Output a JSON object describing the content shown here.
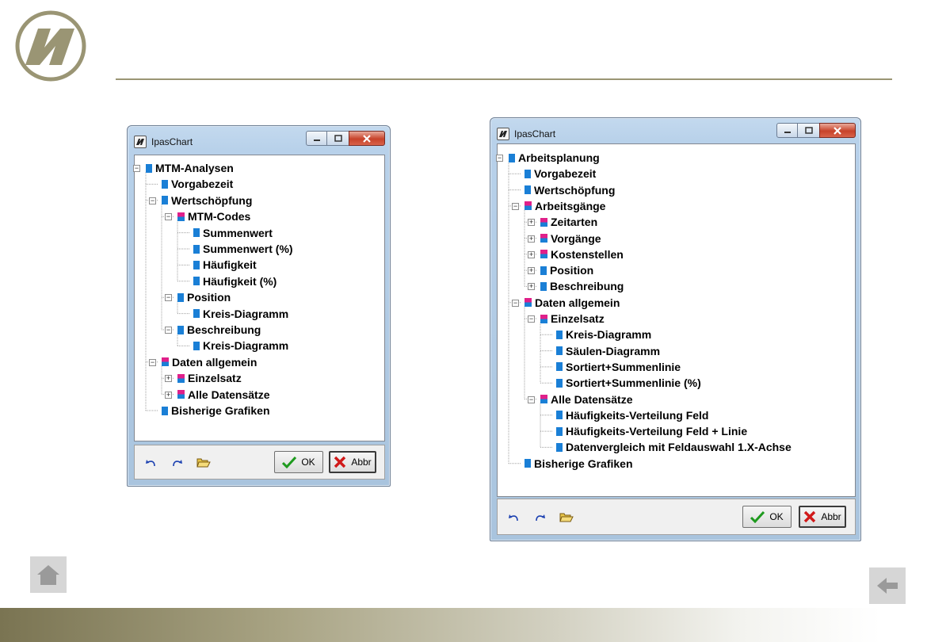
{
  "colors": {
    "accent": "#9a9574",
    "node_blue": "#1a7fd6",
    "node_pink": "#e0208a"
  },
  "window_left": {
    "title": "IpasChart",
    "ok_label": "OK",
    "cancel_label": "Abbr",
    "tree": [
      {
        "label": "MTM-Analysen",
        "level": 0,
        "icon": "leaf",
        "expander": "-"
      },
      {
        "label": "Vorgabezeit",
        "level": 1,
        "icon": "leaf"
      },
      {
        "label": "Wertschöpfung",
        "level": 1,
        "icon": "leaf",
        "expander": "-"
      },
      {
        "label": "MTM-Codes",
        "level": 2,
        "icon": "folder",
        "expander": "-"
      },
      {
        "label": "Summenwert",
        "level": 3,
        "icon": "leaf"
      },
      {
        "label": "Summenwert (%)",
        "level": 3,
        "icon": "leaf"
      },
      {
        "label": "Häufigkeit",
        "level": 3,
        "icon": "leaf"
      },
      {
        "label": "Häufigkeit (%)",
        "level": 3,
        "icon": "leaf"
      },
      {
        "label": "Position",
        "level": 2,
        "icon": "leaf",
        "expander": "-"
      },
      {
        "label": "Kreis-Diagramm",
        "level": 3,
        "icon": "leaf"
      },
      {
        "label": "Beschreibung",
        "level": 2,
        "icon": "leaf",
        "expander": "-"
      },
      {
        "label": "Kreis-Diagramm",
        "level": 3,
        "icon": "leaf"
      },
      {
        "label": "Daten allgemein",
        "level": 1,
        "icon": "folder",
        "expander": "-"
      },
      {
        "label": "Einzelsatz",
        "level": 2,
        "icon": "folder",
        "expander": "+"
      },
      {
        "label": "Alle Datensätze",
        "level": 2,
        "icon": "folder",
        "expander": "+"
      },
      {
        "label": "Bisherige Grafiken",
        "level": 1,
        "icon": "leaf"
      }
    ]
  },
  "window_right": {
    "title": "IpasChart",
    "ok_label": "OK",
    "cancel_label": "Abbr",
    "tree": [
      {
        "label": "Arbeitsplanung",
        "level": 0,
        "icon": "leaf",
        "expander": "-"
      },
      {
        "label": "Vorgabezeit",
        "level": 1,
        "icon": "leaf"
      },
      {
        "label": "Wertschöpfung",
        "level": 1,
        "icon": "leaf"
      },
      {
        "label": "Arbeitsgänge",
        "level": 1,
        "icon": "folder",
        "expander": "-"
      },
      {
        "label": "Zeitarten",
        "level": 2,
        "icon": "folder",
        "expander": "+"
      },
      {
        "label": "Vorgänge",
        "level": 2,
        "icon": "folder",
        "expander": "+"
      },
      {
        "label": "Kostenstellen",
        "level": 2,
        "icon": "folder",
        "expander": "+"
      },
      {
        "label": "Position",
        "level": 2,
        "icon": "leaf",
        "expander": "+"
      },
      {
        "label": "Beschreibung",
        "level": 2,
        "icon": "leaf",
        "expander": "+"
      },
      {
        "label": "Daten allgemein",
        "level": 1,
        "icon": "folder",
        "expander": "-"
      },
      {
        "label": "Einzelsatz",
        "level": 2,
        "icon": "folder",
        "expander": "-"
      },
      {
        "label": "Kreis-Diagramm",
        "level": 3,
        "icon": "leaf"
      },
      {
        "label": "Säulen-Diagramm",
        "level": 3,
        "icon": "leaf"
      },
      {
        "label": "Sortiert+Summenlinie",
        "level": 3,
        "icon": "leaf"
      },
      {
        "label": "Sortiert+Summenlinie (%)",
        "level": 3,
        "icon": "leaf"
      },
      {
        "label": "Alle Datensätze",
        "level": 2,
        "icon": "folder",
        "expander": "-"
      },
      {
        "label": "Häufigkeits-Verteilung Feld",
        "level": 3,
        "icon": "leaf"
      },
      {
        "label": "Häufigkeits-Verteilung Feld + Linie",
        "level": 3,
        "icon": "leaf"
      },
      {
        "label": "Datenvergleich mit Feldauswahl 1.X-Achse",
        "level": 3,
        "icon": "leaf"
      },
      {
        "label": "Bisherige Grafiken",
        "level": 1,
        "icon": "leaf"
      }
    ]
  }
}
